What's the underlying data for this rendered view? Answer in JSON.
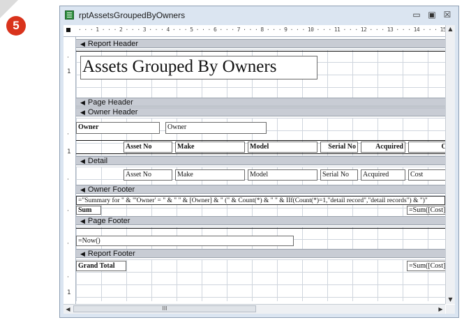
{
  "badge": "5",
  "window": {
    "title": "rptAssetsGroupedByOwners",
    "controls": {
      "minimize": "▭",
      "maximize": "▣",
      "close": "☒"
    }
  },
  "ruler": {
    "scale": "· · · 1 · · · 2 · · · 3 · · · 4 · · · 5 · · · 6 · · · 7 · · · 8 · · · 9 · · · 10 · · · 11 · · · 12 · · · 13 · · · 14 · · · 15 ·"
  },
  "sections": {
    "report_header": "Report Header",
    "page_header": "Page Header",
    "owner_header": "Owner Header",
    "detail": "Detail",
    "owner_footer": "Owner Footer",
    "page_footer": "Page Footer",
    "report_footer": "Report Footer"
  },
  "report_title": "Assets Grouped By Owners",
  "owner_header": {
    "owner_label": "Owner",
    "owner_field": "Owner",
    "columns": [
      "Asset No",
      "Make",
      "Model",
      "Serial No",
      "Acquired",
      "Cost"
    ]
  },
  "detail": {
    "fields": [
      "Asset No",
      "Make",
      "Model",
      "Serial No",
      "Acquired",
      "Cost"
    ]
  },
  "owner_footer": {
    "summary_expr": "=\"Summary for \" & \"'Owner' = \" & \" \" & [Owner] & \" (\" & Count(*) & \" \" & IIf(Count(*)=1,\"detail record\",\"detail records\") & \")\"",
    "sum_label": "Sum",
    "sum_expr": "=Sum([Cost])"
  },
  "page_footer": {
    "now_expr": "=Now()"
  },
  "report_footer": {
    "grand_total_label": "Grand Total",
    "sum_expr": "=Sum([Cost])"
  },
  "scroll": {
    "thumb_grip": "III"
  }
}
